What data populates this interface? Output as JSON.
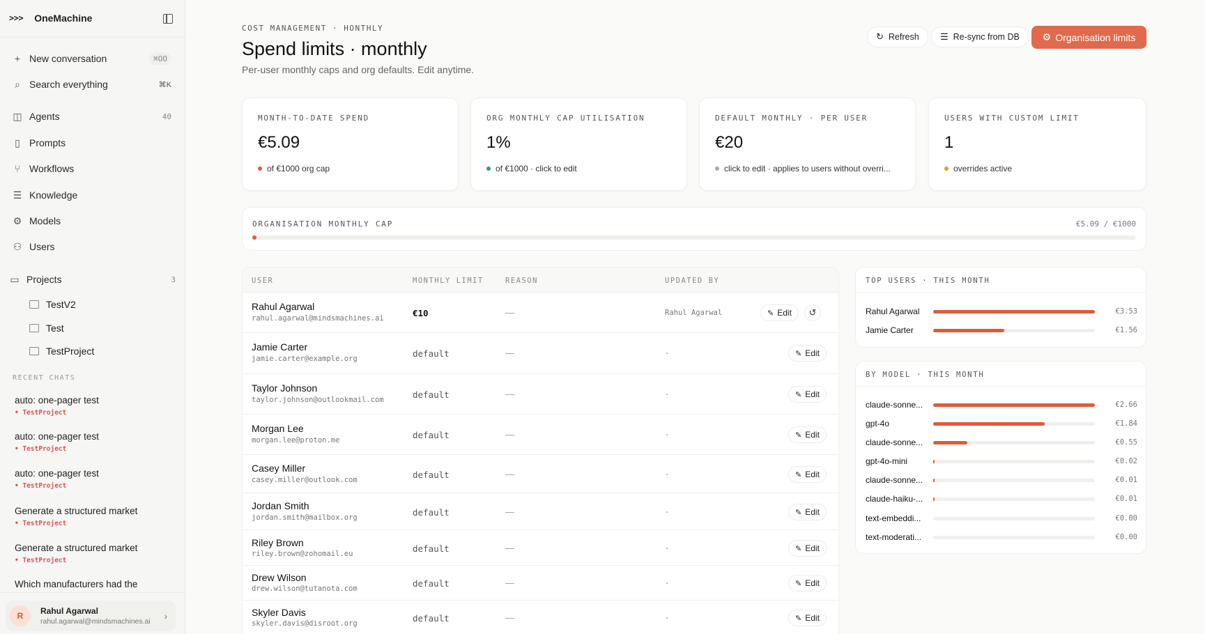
{
  "app": {
    "name": "OneMachine",
    "mark": ">>>"
  },
  "sidebar": {
    "actions": [
      {
        "label": "New conversation",
        "shortcut": "⌘OO",
        "icon": "plus-icon"
      },
      {
        "label": "Search everything",
        "shortcut": "⌘K",
        "icon": "search-icon"
      }
    ],
    "nav": [
      {
        "label": "Agents",
        "count": "40",
        "icon": "bot-icon"
      },
      {
        "label": "Prompts",
        "icon": "book-icon"
      },
      {
        "label": "Workflows",
        "icon": "workflow-icon"
      },
      {
        "label": "Knowledge",
        "icon": "database-icon"
      },
      {
        "label": "Models",
        "icon": "gear-icon"
      },
      {
        "label": "Users",
        "icon": "users-icon"
      }
    ],
    "projects": {
      "label": "Projects",
      "count": "3",
      "items": [
        "TestV2",
        "Test",
        "TestProject"
      ]
    },
    "recent_label": "RECENT CHATS",
    "recent": [
      {
        "title": "auto: one-pager test",
        "project": "TestProject"
      },
      {
        "title": "auto: one-pager test",
        "project": "TestProject"
      },
      {
        "title": "auto: one-pager test",
        "project": "TestProject"
      },
      {
        "title": "Generate a structured market",
        "project": "TestProject"
      },
      {
        "title": "Generate a structured market",
        "project": "TestProject"
      },
      {
        "title": "Which manufacturers had the",
        "project": ""
      }
    ],
    "user": {
      "initial": "R",
      "name": "Rahul Agarwal",
      "email": "rahul.agarwal@mindsmachines.ai"
    }
  },
  "header": {
    "eyebrow": "COST MANAGEMENT · HONTHLY",
    "title": "Spend limits · monthly",
    "subtitle": "Per-user monthly caps and org defaults. Edit anytime.",
    "buttons": {
      "refresh": "Refresh",
      "resync": "Re-sync from DB",
      "org_limits": "Organisation limits"
    }
  },
  "kpis": [
    {
      "label": "MONTH-TO-DATE SPEND",
      "value": "€5.09",
      "note": "of €1000 org cap",
      "dot": "#e05a3a"
    },
    {
      "label": "ORG MONTHLY CAP UTILISATION",
      "value": "1%",
      "note": "of €1000 · click to edit",
      "dot": "#2e9e6b"
    },
    {
      "label": "DEFAULT MONTHLY · PER USER",
      "value": "€20",
      "note": "click to edit · applies to users without overri...",
      "dot": "#aaaaaa"
    },
    {
      "label": "USERS WITH CUSTOM LIMIT",
      "value": "1",
      "note": "overrides active",
      "dot": "#e0a020"
    }
  ],
  "org_cap": {
    "label": "ORGANISATION MONTHLY CAP",
    "amount": "€5.09 / €1000",
    "fraction": 0.005
  },
  "table": {
    "headers": {
      "user": "USER",
      "limit": "MONTHLY LIMIT",
      "reason": "REASON",
      "updated": "UPDATED BY"
    },
    "edit_label": "Edit",
    "rows": [
      {
        "name": "Rahul Agarwal",
        "email": "rahul.agarwal@mindsmachines.ai",
        "limit": "€10",
        "reason": "—",
        "updated_by": "Rahul Agarwal"
      },
      {
        "name": "Jamie Carter",
        "email": "jamie.carter@example.org",
        "limit": "default",
        "reason": "—",
        "updated_by": "-"
      },
      {
        "name": "Taylor Johnson",
        "email": "taylor.johnson@outlookmail.com",
        "limit": "default",
        "reason": "—",
        "updated_by": "-"
      },
      {
        "name": "Morgan Lee",
        "email": "morgan.lee@proton.me",
        "limit": "default",
        "reason": "—",
        "updated_by": "-"
      },
      {
        "name": "Casey Miller",
        "email": "casey.miller@outlook.com",
        "limit": "default",
        "reason": "—",
        "updated_by": "-"
      },
      {
        "name": "Jordan Smith",
        "email": "jordan.smith@mailbox.org",
        "limit": "default",
        "reason": "—",
        "updated_by": "-"
      },
      {
        "name": "Riley Brown",
        "email": "riley.brown@zohomail.eu",
        "limit": "default",
        "reason": "—",
        "updated_by": "-"
      },
      {
        "name": "Drew Wilson",
        "email": "drew.wilson@tutanota.com",
        "limit": "default",
        "reason": "—",
        "updated_by": "-"
      },
      {
        "name": "Skyler Davis",
        "email": "skyler.davis@disroot.org",
        "limit": "default",
        "reason": "—",
        "updated_by": "-"
      }
    ]
  },
  "top_users": {
    "title": "TOP USERS · THIS MONTH",
    "items": [
      {
        "label": "Rahul Agarwal",
        "value": "€3.53",
        "fraction": 1.0
      },
      {
        "label": "Jamie Carter",
        "value": "€1.56",
        "fraction": 0.44
      }
    ]
  },
  "by_model": {
    "title": "BY MODEL · THIS MONTH",
    "items": [
      {
        "label": "claude-sonne...",
        "value": "€2.66",
        "fraction": 1.0
      },
      {
        "label": "gpt-4o",
        "value": "€1.84",
        "fraction": 0.69
      },
      {
        "label": "claude-sonne...",
        "value": "€0.55",
        "fraction": 0.21
      },
      {
        "label": "gpt-4o-mini",
        "value": "€0.02",
        "fraction": 0.008
      },
      {
        "label": "claude-sonne...",
        "value": "€0.01",
        "fraction": 0.004
      },
      {
        "label": "claude-haiku-...",
        "value": "€0.01",
        "fraction": 0.004
      },
      {
        "label": "text-embeddi...",
        "value": "€0.00",
        "fraction": 0
      },
      {
        "label": "text-moderati...",
        "value": "€0.00",
        "fraction": 0
      }
    ]
  }
}
